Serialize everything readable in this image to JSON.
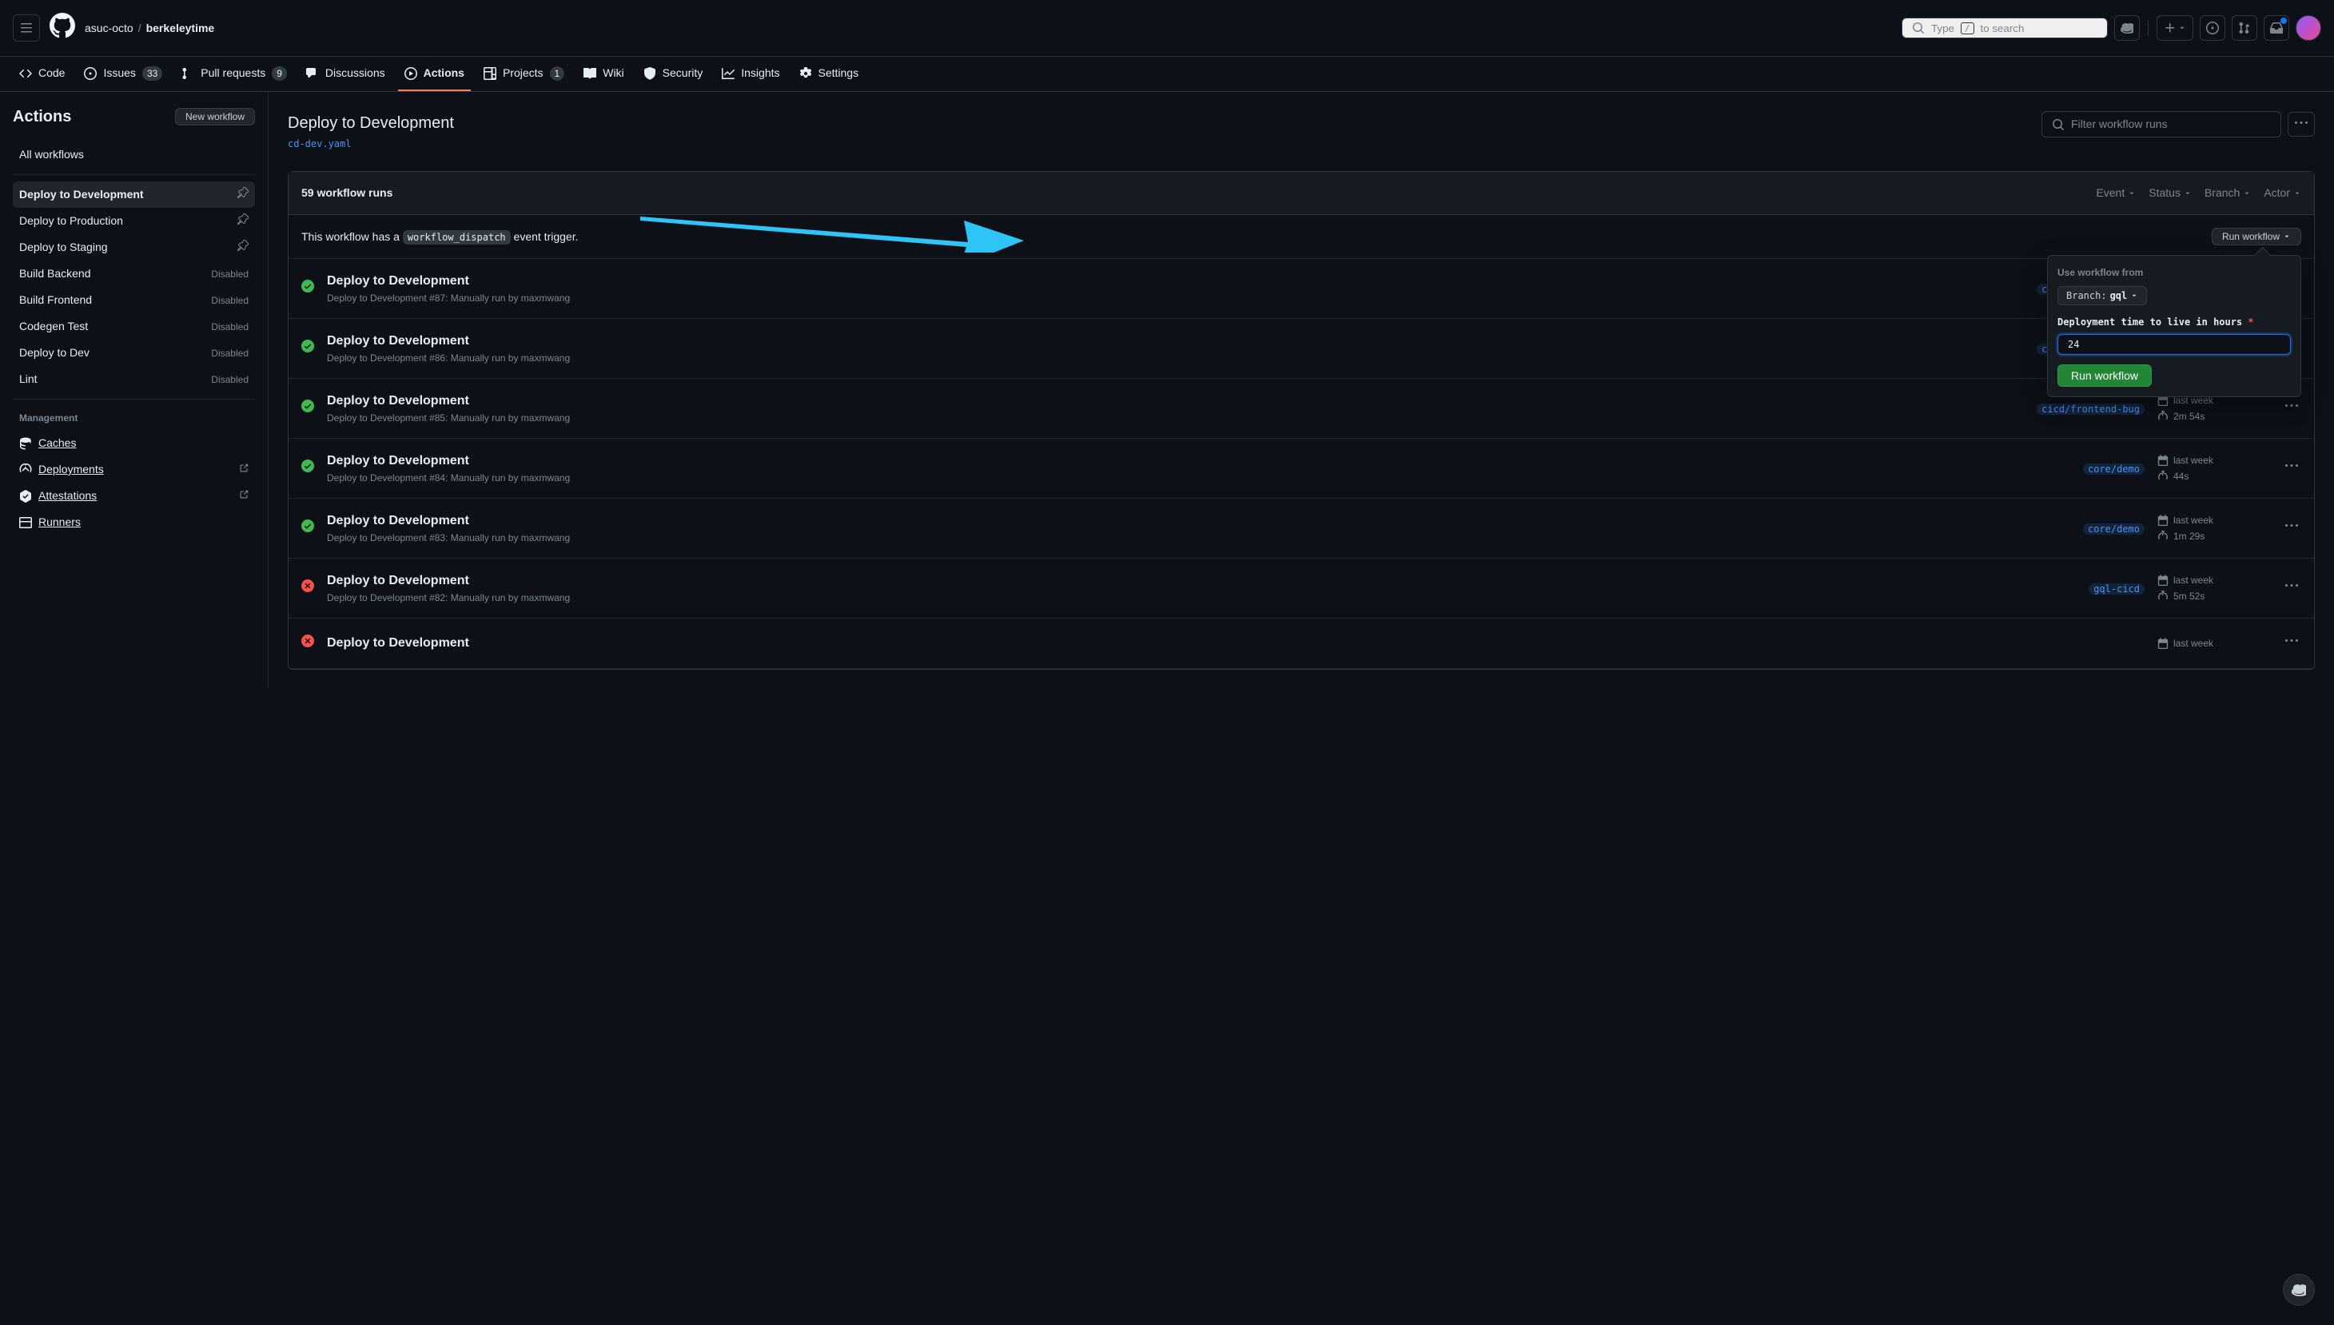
{
  "breadcrumb": {
    "org": "asuc-octo",
    "repo": "berkeleytime"
  },
  "search": {
    "placeholder": "to search",
    "key_hint": "/",
    "prefix": "Type"
  },
  "repo_nav": {
    "code": "Code",
    "issues": "Issues",
    "issues_count": "33",
    "pull_requests": "Pull requests",
    "pr_count": "9",
    "discussions": "Discussions",
    "actions": "Actions",
    "projects": "Projects",
    "projects_count": "1",
    "wiki": "Wiki",
    "security": "Security",
    "insights": "Insights",
    "settings": "Settings"
  },
  "sidebar": {
    "title": "Actions",
    "new_workflow": "New workflow",
    "all_workflows": "All workflows",
    "workflows": [
      {
        "name": "Deploy to Development",
        "status": ""
      },
      {
        "name": "Deploy to Production",
        "status": ""
      },
      {
        "name": "Deploy to Staging",
        "status": ""
      },
      {
        "name": "Build Backend",
        "status": "Disabled"
      },
      {
        "name": "Build Frontend",
        "status": "Disabled"
      },
      {
        "name": "Codegen Test",
        "status": "Disabled"
      },
      {
        "name": "Deploy to Dev",
        "status": "Disabled"
      },
      {
        "name": "Lint",
        "status": "Disabled"
      }
    ],
    "management_heading": "Management",
    "management": [
      {
        "name": "Caches",
        "external": false
      },
      {
        "name": "Deployments",
        "external": true
      },
      {
        "name": "Attestations",
        "external": true
      },
      {
        "name": "Runners",
        "external": false
      }
    ]
  },
  "content": {
    "title": "Deploy to Development",
    "yaml_file": "cd-dev.yaml",
    "filter_placeholder": "Filter workflow runs",
    "runs_count": "59 workflow runs",
    "dispatch_text_pre": "This workflow has a ",
    "dispatch_code": "workflow_dispatch",
    "dispatch_text_post": " event trigger.",
    "run_workflow_label": "Run workflow",
    "filters": {
      "event": "Event",
      "status": "Status",
      "branch": "Branch",
      "actor": "Actor"
    }
  },
  "popup": {
    "use_from_label": "Use workflow from",
    "branch_prefix": "Branch:",
    "branch_value": "gql",
    "ttl_label": "Deployment time to live in hours",
    "ttl_value": "24",
    "submit": "Run workflow"
  },
  "runs": [
    {
      "status": "success",
      "title": "Deploy to Development",
      "subtitle": "Deploy to Development #87: Manually run by maxmwang",
      "branch": "cicd/frontend-bug",
      "when": "",
      "duration": ""
    },
    {
      "status": "success",
      "title": "Deploy to Development",
      "subtitle": "Deploy to Development #86: Manually run by maxmwang",
      "branch": "cicd/frontend-bug",
      "when": "",
      "duration": ""
    },
    {
      "status": "success",
      "title": "Deploy to Development",
      "subtitle": "Deploy to Development #85: Manually run by maxmwang",
      "branch": "cicd/frontend-bug",
      "when": "last week",
      "duration": "2m 54s"
    },
    {
      "status": "success",
      "title": "Deploy to Development",
      "subtitle": "Deploy to Development #84: Manually run by maxmwang",
      "branch": "core/demo",
      "when": "last week",
      "duration": "44s"
    },
    {
      "status": "success",
      "title": "Deploy to Development",
      "subtitle": "Deploy to Development #83: Manually run by maxmwang",
      "branch": "core/demo",
      "when": "last week",
      "duration": "1m 29s"
    },
    {
      "status": "fail",
      "title": "Deploy to Development",
      "subtitle": "Deploy to Development #82: Manually run by maxmwang",
      "branch": "gql-cicd",
      "when": "last week",
      "duration": "5m 52s"
    },
    {
      "status": "fail",
      "title": "Deploy to Development",
      "subtitle": "",
      "branch": "",
      "when": "last week",
      "duration": ""
    }
  ]
}
